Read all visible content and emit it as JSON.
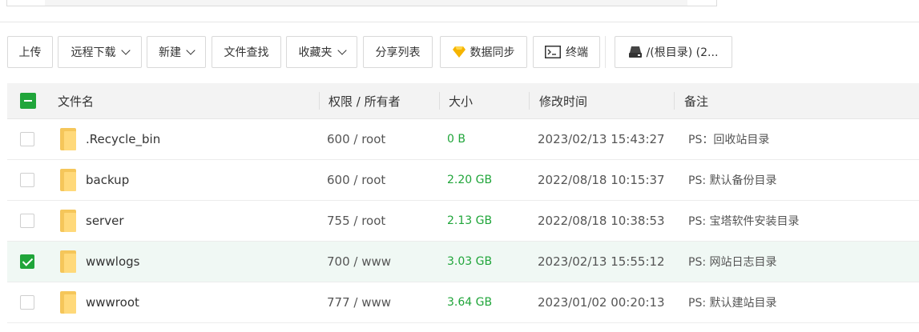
{
  "toolbar": {
    "upload": "上传",
    "remote_download": "远程下载",
    "new": "新建",
    "file_search": "文件查找",
    "favorites": "收藏夹",
    "share_list": "分享列表",
    "data_sync": "数据同步",
    "terminal": "终端",
    "disk": "/(根目录) (2..."
  },
  "colors": {
    "accent": "#20a53a",
    "sync_icon": "#f5b400",
    "header_bg": "#f3f3f3",
    "selected_row_bg": "#f0f8f4"
  },
  "table": {
    "headers": {
      "name": "文件名",
      "perm_owner": "权限 / 所有者",
      "size": "大小",
      "modified": "修改时间",
      "note": "备注"
    },
    "rows": [
      {
        "name": ".Recycle_bin",
        "perm": "600 / root",
        "size": "0 B",
        "modified": "2023/02/13 15:43:27",
        "note": "PS：回收站目录",
        "checked": false
      },
      {
        "name": "backup",
        "perm": "600 / root",
        "size": "2.20 GB",
        "modified": "2022/08/18 10:15:37",
        "note": "PS: 默认备份目录",
        "checked": false
      },
      {
        "name": "server",
        "perm": "755 / root",
        "size": "2.13 GB",
        "modified": "2022/08/18 10:38:53",
        "note": "PS: 宝塔软件安装目录",
        "checked": false
      },
      {
        "name": "wwwlogs",
        "perm": "700 / www",
        "size": "3.03 GB",
        "modified": "2023/02/13 15:55:12",
        "note": "PS: 网站日志目录",
        "checked": true
      },
      {
        "name": "wwwroot",
        "perm": "777 / www",
        "size": "3.64 GB",
        "modified": "2023/01/02 00:20:13",
        "note": "PS: 默认建站目录",
        "checked": false
      }
    ]
  }
}
